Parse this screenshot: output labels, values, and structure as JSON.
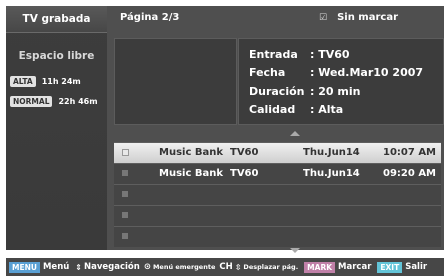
{
  "left_panel": {
    "title": "TV grabada",
    "space_label": "Espacio libre",
    "quality": [
      {
        "badge": "ALTA",
        "time": "11h 24m"
      },
      {
        "badge": "NORMAL",
        "time": "22h 46m"
      }
    ]
  },
  "header": {
    "page": "Página 2/3",
    "unmarked": "Sin marcar"
  },
  "info": {
    "rows": [
      {
        "key": "Entrada",
        "value": ": TV60"
      },
      {
        "key": "Fecha",
        "value": ": Wed.Mar10 2007"
      },
      {
        "key": "Duración",
        "value": ": 20 min"
      },
      {
        "key": "Calidad",
        "value": ": Alta"
      }
    ]
  },
  "list": {
    "rows": [
      {
        "title": "Music Bank",
        "channel": "TV60",
        "date": "Thu.Jun14",
        "time": "10:07 AM"
      },
      {
        "title": "Music Bank",
        "channel": "TV60",
        "date": "Thu.Jun14",
        "time": "09:20 AM"
      },
      {
        "title": "",
        "channel": "",
        "date": "",
        "time": ""
      },
      {
        "title": "",
        "channel": "",
        "date": "",
        "time": ""
      },
      {
        "title": "",
        "channel": "",
        "date": "",
        "time": ""
      }
    ]
  },
  "footer": {
    "menu_key": "MENU",
    "menu_label": "Menú",
    "nav_label": "Navegación",
    "popup_label": "Menú emergente",
    "ch_key": "CH",
    "scroll_label": "Desplazar pág.",
    "mark_key": "MARK",
    "mark_label": "Marcar",
    "exit_key": "EXIT",
    "exit_label": "Salir"
  }
}
